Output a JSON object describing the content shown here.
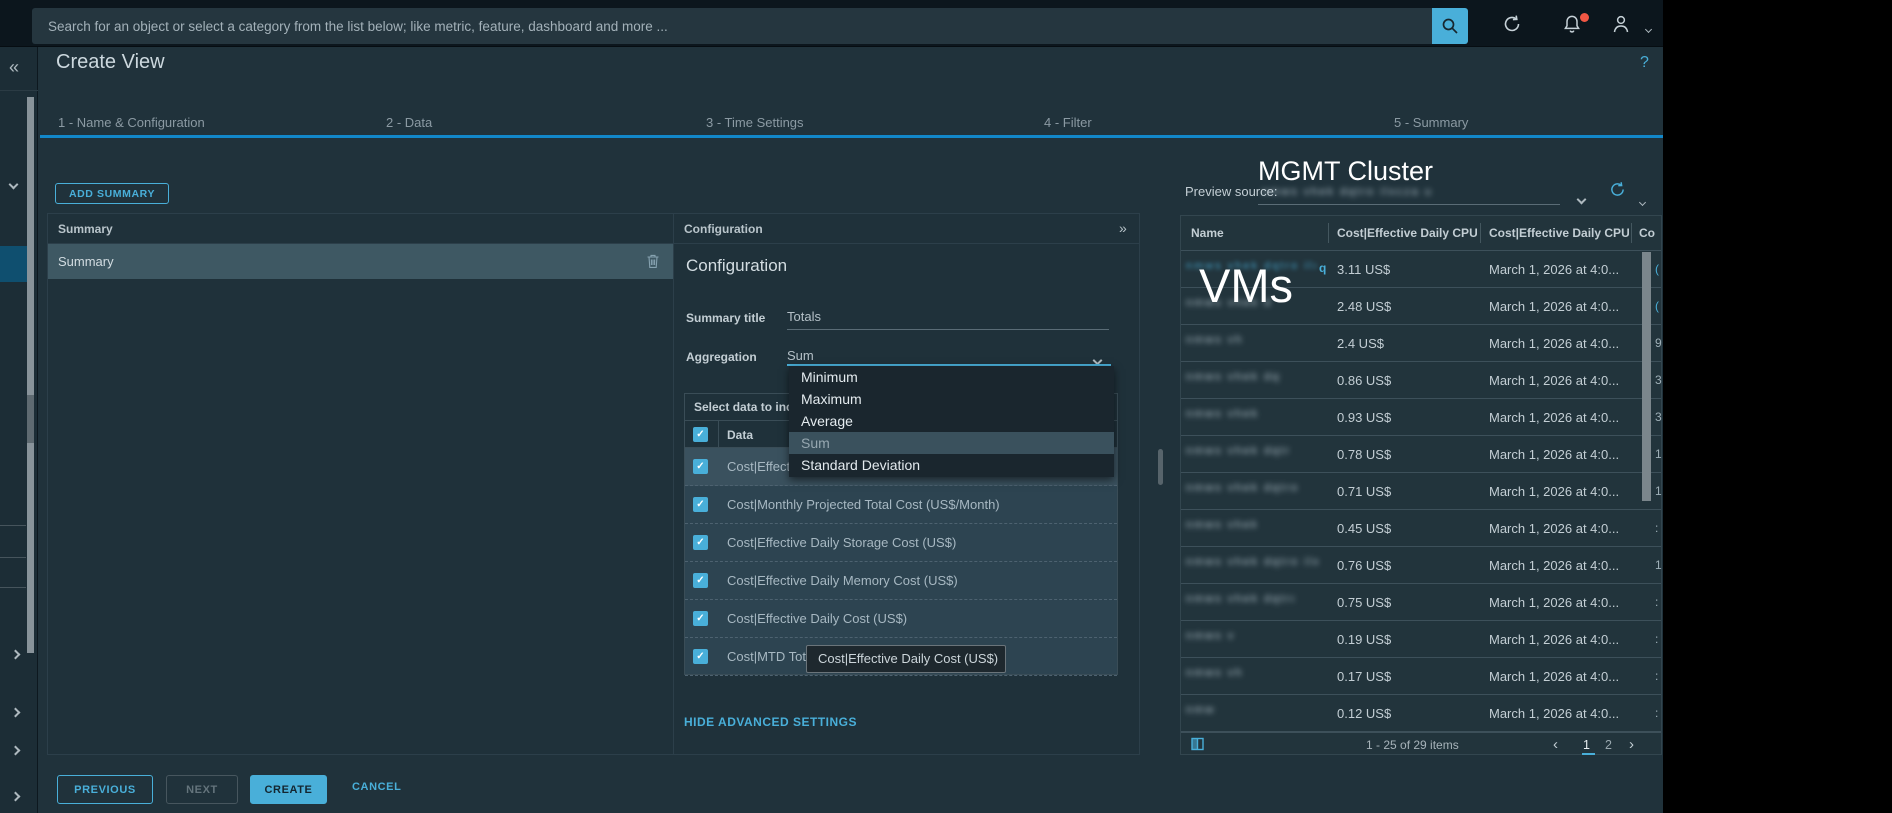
{
  "topbar": {
    "search_placeholder": "Search for an object or select a category from the list below; like metric, feature, dashboard and more ...",
    "icons": [
      "search-icon",
      "refresh-icon",
      "bell-icon",
      "user-icon",
      "chevron-down-icon"
    ]
  },
  "page": {
    "title": "Create View",
    "help_glyph": "?"
  },
  "wizard": {
    "steps": [
      {
        "label": "1 - Name & Configuration"
      },
      {
        "label": "2 - Data"
      },
      {
        "label": "3 - Time Settings"
      },
      {
        "label": "4 - Filter"
      },
      {
        "label": "5 - Summary"
      }
    ],
    "active_step": "5 - Summary"
  },
  "summary_panel": {
    "add_button_label": "ADD SUMMARY",
    "col_summary": "Summary",
    "col_configuration": "Configuration",
    "expand_glyph": "»",
    "rows": [
      {
        "label": "Summary",
        "selected": true
      }
    ]
  },
  "configuration": {
    "section_title": "Configuration",
    "summary_title_label": "Summary title",
    "summary_title_value": "Totals",
    "aggregation_label": "Aggregation",
    "aggregation_value": "Sum",
    "dropdown_options": [
      {
        "label": "Minimum",
        "selected": false
      },
      {
        "label": "Maximum",
        "selected": false
      },
      {
        "label": "Average",
        "selected": false
      },
      {
        "label": "Sum",
        "selected": true
      },
      {
        "label": "Standard Deviation",
        "selected": false
      }
    ],
    "select_data_header_visible": "Select data to inc",
    "data_column_label": "Data",
    "data_rows": [
      {
        "label": "Cost|Effecti",
        "checked": true,
        "truncated": true
      },
      {
        "label": "Cost|Monthly Projected Total Cost (US$/Month)",
        "checked": true
      },
      {
        "label": "Cost|Effective Daily Storage Cost (US$)",
        "checked": true
      },
      {
        "label": "Cost|Effective Daily Memory Cost (US$)",
        "checked": true
      },
      {
        "label": "Cost|Effective Daily Cost (US$)",
        "checked": true
      },
      {
        "label": "Cost|MTD Tot",
        "checked": true,
        "truncated": true
      }
    ],
    "tooltip_text": "Cost|Effective Daily Cost (US$)",
    "advanced_link_label": "HIDE ADVANCED SETTINGS"
  },
  "wizard_buttons": {
    "previous": "PREVIOUS",
    "next": "NEXT",
    "create": "CREATE",
    "cancel": "CANCEL"
  },
  "preview": {
    "source_label": "Preview source:",
    "source_value_redacted": true,
    "columns": [
      "Name",
      "Cost|Effective Daily CPU ...",
      "Cost|Effective Daily CPU ...",
      "Co"
    ],
    "rows": [
      {
        "name_redacted": true,
        "cost": "3.11 US$",
        "time": "March 1, 2026 at 4:0...",
        "fragment": "(",
        "fragment_blue": true
      },
      {
        "name_redacted": true,
        "cost": "2.48 US$",
        "time": "March 1, 2026 at 4:0...",
        "fragment": "(",
        "fragment_blue": true
      },
      {
        "name_redacted": true,
        "cost": "2.4 US$",
        "time": "March 1, 2026 at 4:0...",
        "fragment": "9",
        "fragment_blue": false
      },
      {
        "name_redacted": true,
        "cost": "0.86 US$",
        "time": "March 1, 2026 at 4:0...",
        "fragment": "3",
        "fragment_blue": false
      },
      {
        "name_redacted": true,
        "cost": "0.93 US$",
        "time": "March 1, 2026 at 4:0...",
        "fragment": "3",
        "fragment_blue": false
      },
      {
        "name_redacted": true,
        "cost": "0.78 US$",
        "time": "March 1, 2026 at 4:0...",
        "fragment": "1",
        "fragment_blue": false
      },
      {
        "name_redacted": true,
        "cost": "0.71 US$",
        "time": "March 1, 2026 at 4:0...",
        "fragment": "1",
        "fragment_blue": false
      },
      {
        "name_redacted": true,
        "cost": "0.45 US$",
        "time": "March 1, 2026 at 4:0...",
        "fragment": ":",
        "fragment_blue": false
      },
      {
        "name_redacted": true,
        "cost": "0.76 US$",
        "time": "March 1, 2026 at 4:0...",
        "fragment": "1",
        "fragment_blue": false
      },
      {
        "name_redacted": true,
        "cost": "0.75 US$",
        "time": "March 1, 2026 at 4:0...",
        "fragment": ":",
        "fragment_blue": false
      },
      {
        "name_redacted": true,
        "cost": "0.19 US$",
        "time": "March 1, 2026 at 4:0...",
        "fragment": ":",
        "fragment_blue": false
      },
      {
        "name_redacted": true,
        "cost": "0.17 US$",
        "time": "March 1, 2026 at 4:0...",
        "fragment": ":",
        "fragment_blue": false
      },
      {
        "name_redacted": true,
        "cost": "0.12 US$",
        "time": "March 1, 2026 at 4:0...",
        "fragment": ":",
        "fragment_blue": false
      }
    ],
    "footer": {
      "items_range": "1 - 25 of 29 items",
      "pages": [
        "1",
        "2"
      ],
      "current_page": "1",
      "prev_glyph": "‹",
      "next_glyph": "›"
    }
  },
  "annotations": {
    "cluster_label": "MGMT Cluster",
    "vms_label": "VMs"
  },
  "colors": {
    "accent_blue": "#49afd9",
    "step_line_blue": "#1287c9",
    "notification_dot": "#f25744",
    "selected_row": "#3e5863",
    "topbar": "#0c161d",
    "background": "#20323b"
  }
}
